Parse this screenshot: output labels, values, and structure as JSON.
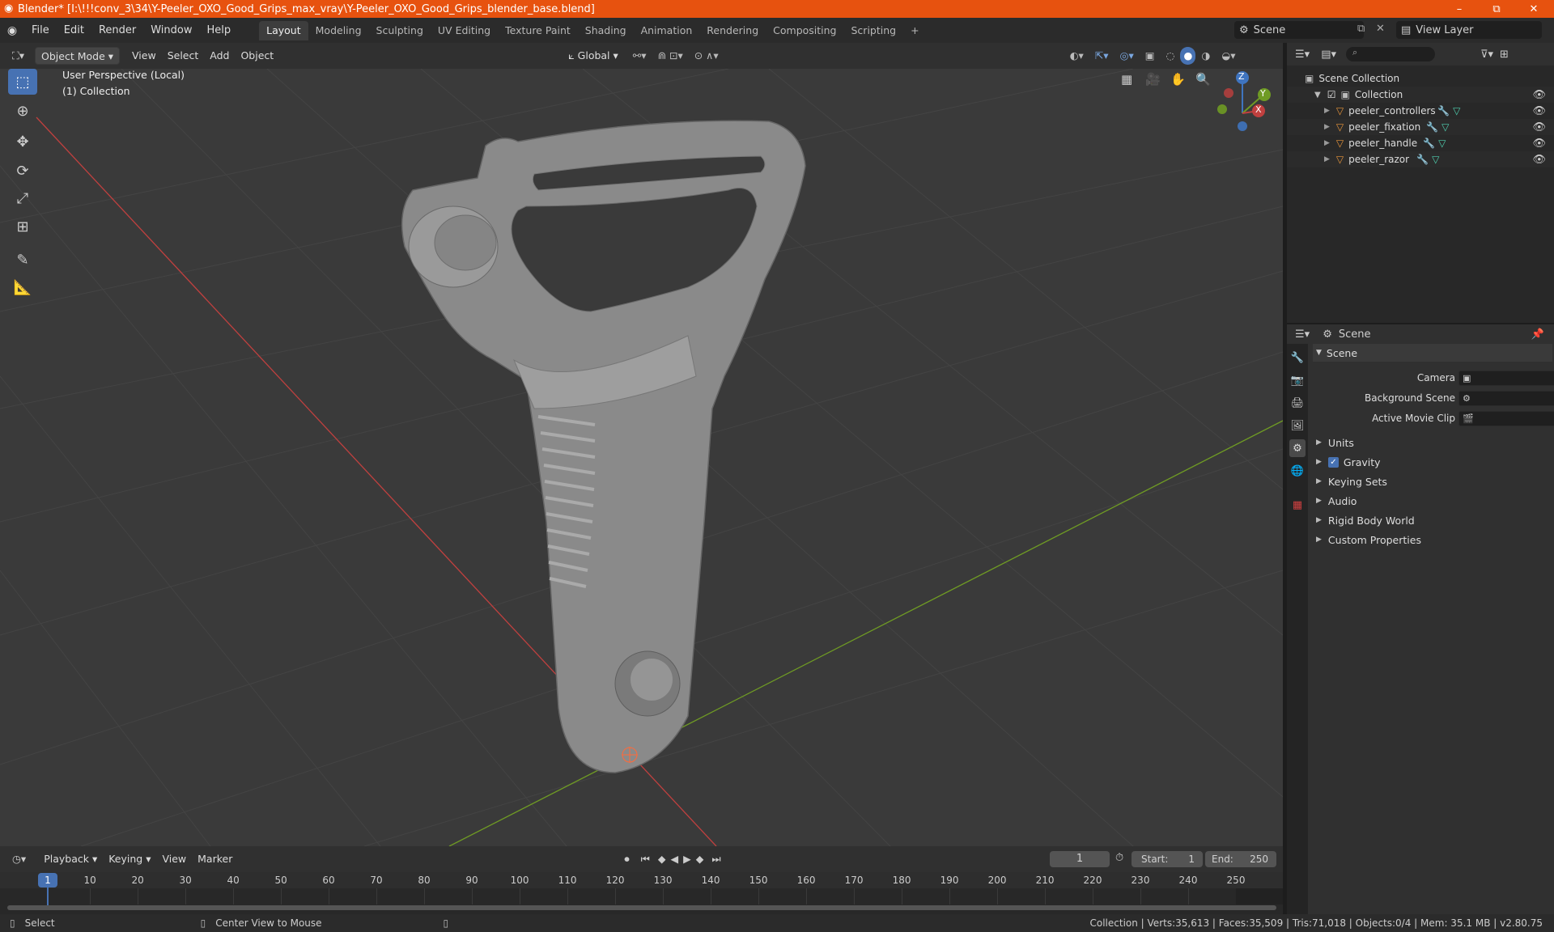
{
  "window": {
    "title": "Blender* [I:\\!!!conv_3\\34\\Y-Peeler_OXO_Good_Grips_max_vray\\Y-Peeler_OXO_Good_Grips_blender_base.blend]",
    "controls": {
      "minimize": "–",
      "maximize": "⧉",
      "close": "✕"
    }
  },
  "menu": {
    "items": [
      "File",
      "Edit",
      "Render",
      "Window",
      "Help"
    ],
    "workspaces": [
      "Layout",
      "Modeling",
      "Sculpting",
      "UV Editing",
      "Texture Paint",
      "Shading",
      "Animation",
      "Rendering",
      "Compositing",
      "Scripting"
    ],
    "active_workspace": "Layout",
    "add_tab": "+",
    "scene": "Scene",
    "view_layer": "View Layer"
  },
  "viewport_header": {
    "mode": "Object Mode",
    "menus": [
      "View",
      "Select",
      "Add",
      "Object"
    ],
    "orientation": "Global"
  },
  "viewport": {
    "perspective": "User Perspective (Local)",
    "collection": "(1) Collection",
    "gizmo": {
      "z": "Z",
      "y": "Y",
      "x": "X"
    },
    "colors": {
      "x_axis": "#c0403f",
      "y_axis": "#6f9b24",
      "grid": "#474747",
      "bg": "#3a3a3a",
      "selected_tool": "#4772b3"
    }
  },
  "outliner": {
    "root": "Scene Collection",
    "collection": "Collection",
    "objects": [
      "peeler_controllers",
      "peeler_fixation",
      "peeler_handle",
      "peeler_razor"
    ]
  },
  "properties": {
    "context": "Scene",
    "panel": "Scene",
    "fields": [
      {
        "label": "Camera",
        "value": ""
      },
      {
        "label": "Background Scene",
        "value": ""
      },
      {
        "label": "Active Movie Clip",
        "value": ""
      }
    ],
    "subpanels": [
      "Units",
      "Gravity",
      "Keying Sets",
      "Audio",
      "Rigid Body World",
      "Custom Properties"
    ],
    "gravity_checked": true
  },
  "timeline": {
    "menus": [
      "Playback",
      "Keying",
      "View",
      "Marker"
    ],
    "current_frame": "1",
    "start_label": "Start:",
    "start": "1",
    "end_label": "End:",
    "end": "250",
    "ticks": [
      "1",
      "10",
      "20",
      "30",
      "40",
      "50",
      "60",
      "70",
      "80",
      "90",
      "100",
      "110",
      "120",
      "130",
      "140",
      "150",
      "160",
      "170",
      "180",
      "190",
      "200",
      "210",
      "220",
      "230",
      "240",
      "250"
    ]
  },
  "status": {
    "select": "Select",
    "center": "Center View to Mouse",
    "stats": "Collection | Verts:35,613 | Faces:35,509 | Tris:71,018 | Objects:0/4 | Mem: 35.1 MB | v2.80.75"
  }
}
